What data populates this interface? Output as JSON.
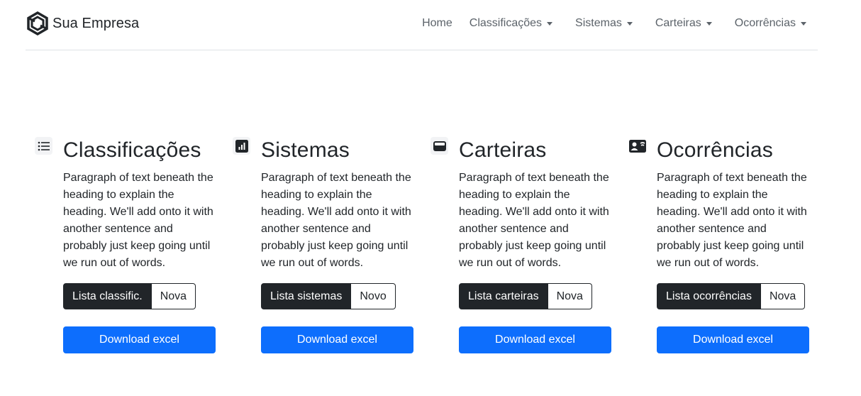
{
  "brand": {
    "name": "Sua Empresa",
    "logo_icon": "hexagon-logo-icon"
  },
  "nav": {
    "items": [
      {
        "label": "Home",
        "dropdown": false
      },
      {
        "label": "Classificações",
        "dropdown": true
      },
      {
        "label": "Sistemas",
        "dropdown": true
      },
      {
        "label": "Carteiras",
        "dropdown": true
      },
      {
        "label": "Ocorrências",
        "dropdown": true
      }
    ]
  },
  "colors": {
    "primary": "#0d6efd",
    "dark": "#212529",
    "muted": "#5c636a",
    "border": "#dee2e6"
  },
  "features": [
    {
      "icon": "list-icon",
      "title": "Classificações",
      "text": "Paragraph of text beneath the heading to explain the heading. We'll add onto it with another sentence and probably just keep going until we run out of words.",
      "list_label": "Lista classific.",
      "new_label": "Nova",
      "download_label": "Download excel"
    },
    {
      "icon": "bar-chart-icon",
      "title": "Sistemas",
      "text": "Paragraph of text beneath the heading to explain the heading. We'll add onto it with another sentence and probably just keep going until we run out of words.",
      "list_label": "Lista sistemas",
      "new_label": "Novo",
      "download_label": "Download excel"
    },
    {
      "icon": "wallet-icon",
      "title": "Carteiras",
      "text": "Paragraph of text beneath the heading to explain the heading. We'll add onto it with another sentence and probably just keep going until we run out of words.",
      "list_label": "Lista carteiras",
      "new_label": "Nova",
      "download_label": "Download excel"
    },
    {
      "icon": "person-card-icon",
      "title": "Ocorrências",
      "text": "Paragraph of text beneath the heading to explain the heading. We'll add onto it with another sentence and probably just keep going until we run out of words.",
      "list_label": "Lista ocorrências",
      "new_label": "Nova",
      "download_label": "Download excel"
    }
  ]
}
